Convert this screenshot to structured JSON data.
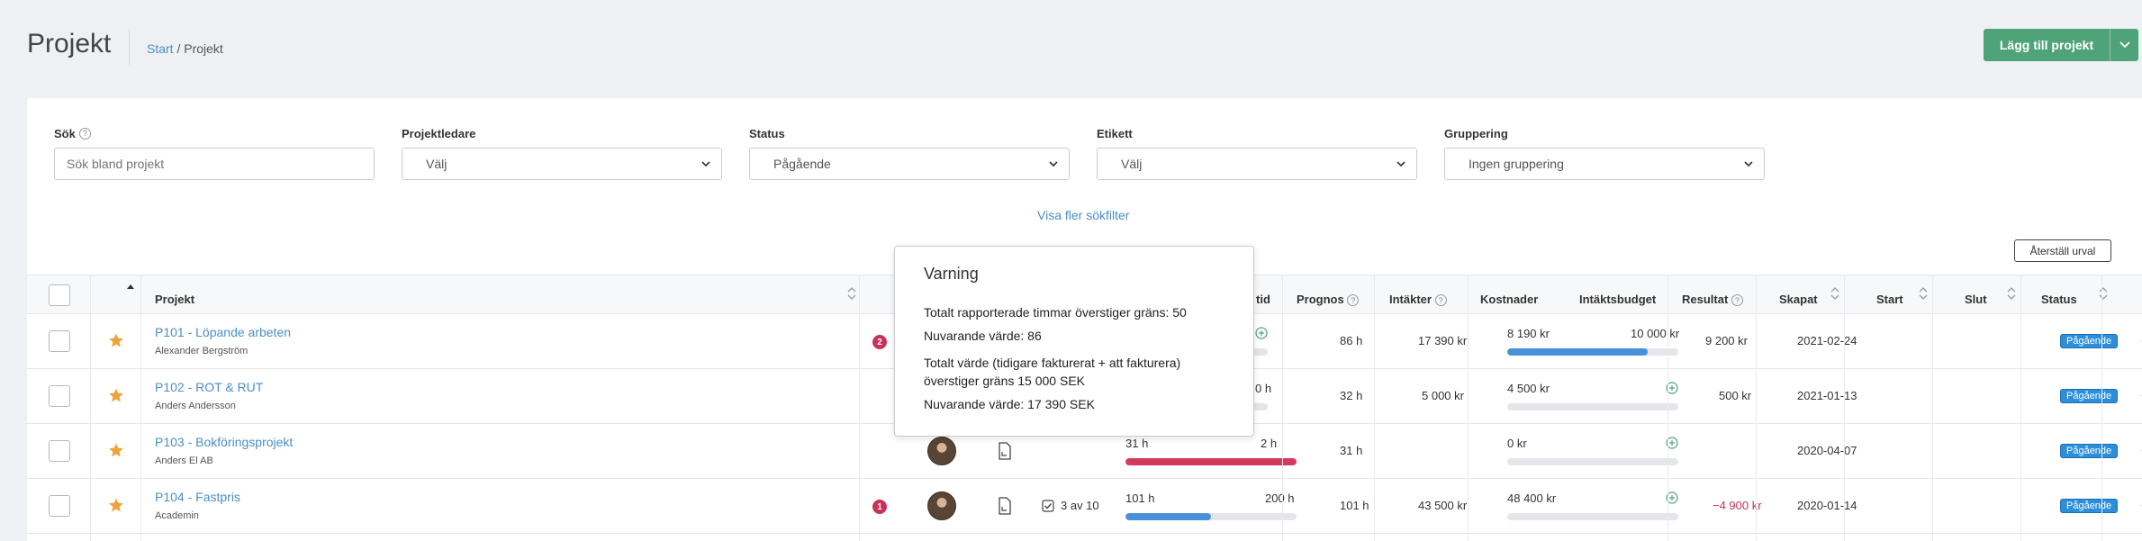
{
  "header": {
    "title": "Projekt",
    "breadcrumb_home": "Start",
    "breadcrumb_sep": "/",
    "breadcrumb_current": "Projekt",
    "add_button": "Lägg till projekt"
  },
  "filters": {
    "search": {
      "label": "Sök",
      "placeholder": "Sök bland projekt"
    },
    "manager": {
      "label": "Projektledare",
      "value": "Välj"
    },
    "status": {
      "label": "Status",
      "value": "Pågående"
    },
    "tag": {
      "label": "Etikett",
      "value": "Välj"
    },
    "grouping": {
      "label": "Gruppering",
      "value": "Ingen gruppering"
    },
    "more_filters": "Visa fler sökfilter",
    "reset": "Återställ urval"
  },
  "columns": {
    "project": "Projekt",
    "time": "tid",
    "forecast": "Prognos",
    "income": "Intäkter",
    "costs": "Kostnader",
    "income_budget": "Intäktsbudget",
    "result": "Resultat",
    "created": "Skapat",
    "start": "Start",
    "end": "Slut",
    "status": "Status"
  },
  "rows": [
    {
      "name": "P101 - Löpande arbeten",
      "client": "Alexander Bergström",
      "badge": "2",
      "forecast": "86 h",
      "income": "17 390 kr",
      "cost": "8 190 kr",
      "budget": "10 000 kr",
      "cost_fill": 0.82,
      "result": "9 200 kr",
      "created": "2021-02-24",
      "status": "Pågående"
    },
    {
      "name": "P102 - ROT & RUT",
      "client": "Anders Andersson",
      "time_right": "0 h",
      "forecast": "32 h",
      "income": "5 000 kr",
      "cost": "4 500 kr",
      "result": "500 kr",
      "created": "2021-01-13",
      "status": "Pågående"
    },
    {
      "name": "P103 - Bokföringsprojekt",
      "client": "Anders El AB",
      "time_left": "31 h",
      "time_right": "2 h",
      "time_fill": 1.0,
      "forecast": "31 h",
      "cost": "0 kr",
      "created": "2020-04-07",
      "status": "Pågående"
    },
    {
      "name": "P104 - Fastpris",
      "client": "Academin",
      "badge": "1",
      "tasks": "3 av 10",
      "time_left": "101 h",
      "time_right": "200 h",
      "time_fill": 0.5,
      "forecast": "101 h",
      "income": "43 500 kr",
      "cost": "48 400 kr",
      "result": "−4 900 kr",
      "created": "2020-01-14",
      "status": "Pågående"
    }
  ],
  "tooltip": {
    "title": "Varning",
    "line1": "Totalt rapporterade timmar överstiger gräns: 50",
    "line2": "Nuvarande värde: 86",
    "line3": "Totalt värde (tidigare fakturerat + att fakturera) överstiger gräns 15 000 SEK",
    "line4": "Nuvarande värde: 17 390 SEK"
  },
  "colors": {
    "accent": "#4a8ec8",
    "add_button": "#4fa378",
    "cost_bar": "#4a90d9",
    "time_bar_over": "#d23a5e",
    "time_bar": "#4a90d9",
    "status_pill": "#2d8fd9",
    "negative": "#c9305a",
    "star": "#f0a23a"
  }
}
